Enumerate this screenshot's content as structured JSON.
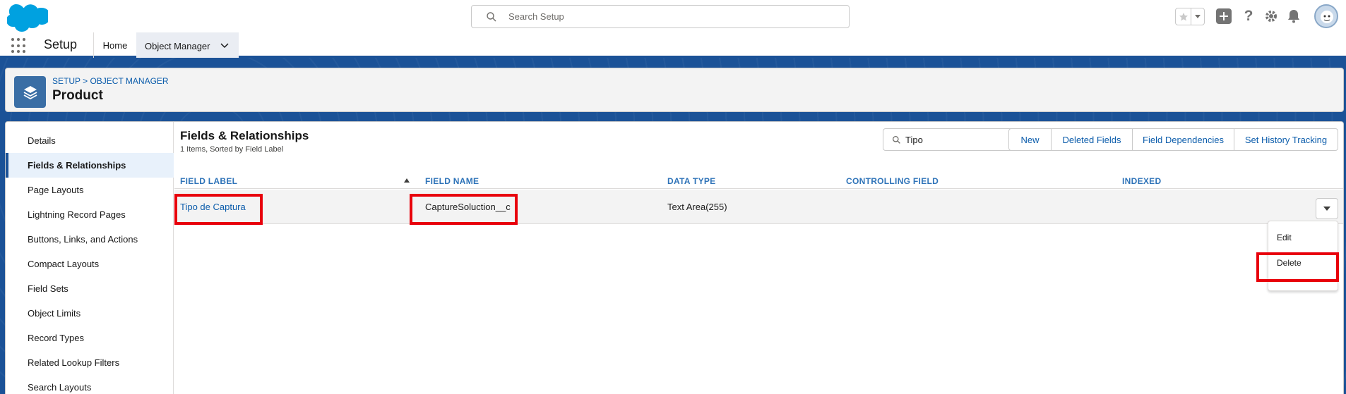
{
  "header": {
    "search_placeholder": "Search Setup"
  },
  "context": {
    "app_name": "Setup",
    "tabs": [
      {
        "label": "Home"
      },
      {
        "label": "Object Manager"
      }
    ]
  },
  "object": {
    "breadcrumb": "SETUP > OBJECT MANAGER",
    "title": "Product"
  },
  "sidebar": {
    "items": [
      {
        "label": "Details"
      },
      {
        "label": "Fields & Relationships"
      },
      {
        "label": "Page Layouts"
      },
      {
        "label": "Lightning Record Pages"
      },
      {
        "label": "Buttons, Links, and Actions"
      },
      {
        "label": "Compact Layouts"
      },
      {
        "label": "Field Sets"
      },
      {
        "label": "Object Limits"
      },
      {
        "label": "Record Types"
      },
      {
        "label": "Related Lookup Filters"
      },
      {
        "label": "Search Layouts"
      }
    ]
  },
  "content": {
    "title": "Fields & Relationships",
    "subtitle": "1 Items, Sorted by Field Label",
    "quick_find_value": "Tipo",
    "buttons": [
      "New",
      "Deleted Fields",
      "Field Dependencies",
      "Set History Tracking"
    ],
    "columns": [
      "FIELD LABEL",
      "FIELD NAME",
      "DATA TYPE",
      "CONTROLLING FIELD",
      "INDEXED"
    ],
    "rows": [
      {
        "field_label": "Tipo de Captura",
        "field_name": "CaptureSoluction__c",
        "data_type": "Text Area(255)",
        "controlling_field": "",
        "indexed": ""
      }
    ],
    "row_menu": [
      "Edit",
      "Delete"
    ]
  },
  "colors": {
    "brand_blue": "#1b5297",
    "link": "#0b5cab",
    "highlight": "#e8000b"
  }
}
